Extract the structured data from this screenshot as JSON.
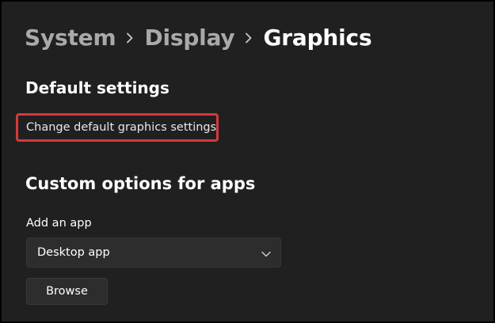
{
  "breadcrumb": {
    "items": [
      "System",
      "Display",
      "Graphics"
    ],
    "separator_icon": "chevron-right-icon"
  },
  "default_settings": {
    "title": "Default settings",
    "link_label": "Change default graphics settings",
    "highlight_color": "#d9383c"
  },
  "custom_options": {
    "title": "Custom options for apps",
    "add_app_label": "Add an app",
    "dropdown": {
      "selected": "Desktop app",
      "icon": "chevron-down-icon"
    },
    "browse_label": "Browse"
  },
  "colors": {
    "background": "#202020",
    "text_primary": "#ffffff",
    "text_secondary": "#a9a9a9",
    "control_background": "#2d2d2d"
  }
}
